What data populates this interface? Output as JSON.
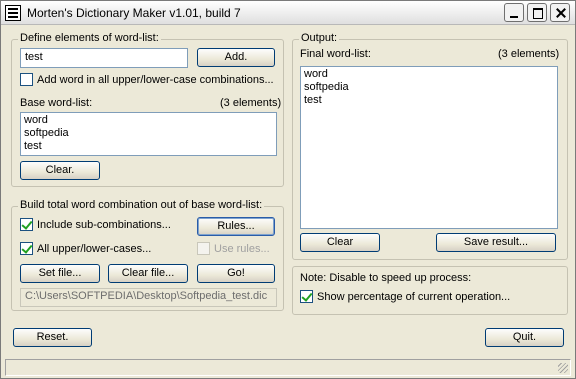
{
  "window": {
    "title": "Morten's Dictionary Maker v1.01, build 7"
  },
  "define": {
    "group_title": "Define elements of word-list:",
    "input_value": "test",
    "add_label": "Add.",
    "case_combo_label": "Add word in all upper/lower-case combinations...",
    "case_combo_checked": false
  },
  "base": {
    "label": "Base word-list:",
    "count": "(3 elements)",
    "items": [
      "word",
      "softpedia",
      "test"
    ],
    "clear_label": "Clear."
  },
  "build": {
    "group_title": "Build total word combination out of base word-list:",
    "sub_combinations_label": "Include sub-combinations...",
    "sub_combinations_checked": true,
    "rules_label": "Rules...",
    "all_case_label": "All upper/lower-cases...",
    "all_case_checked": true,
    "use_rules_label": "Use rules...",
    "use_rules_checked": false,
    "set_file_label": "Set file...",
    "clear_file_label": "Clear file...",
    "go_label": "Go!",
    "file_path": "C:\\Users\\SOFTPEDIA\\Desktop\\Softpedia_test.dic"
  },
  "output": {
    "group_title": "Output:",
    "final_label": "Final word-list:",
    "count": "(3 elements)",
    "items": [
      "word",
      "softpedia",
      "test"
    ],
    "clear_label": "Clear",
    "save_label": "Save result..."
  },
  "note": {
    "title": "Note: Disable to speed up process:",
    "show_percentage_label": "Show percentage of current operation...",
    "show_percentage_checked": true
  },
  "footer": {
    "reset_label": "Reset.",
    "quit_label": "Quit."
  }
}
